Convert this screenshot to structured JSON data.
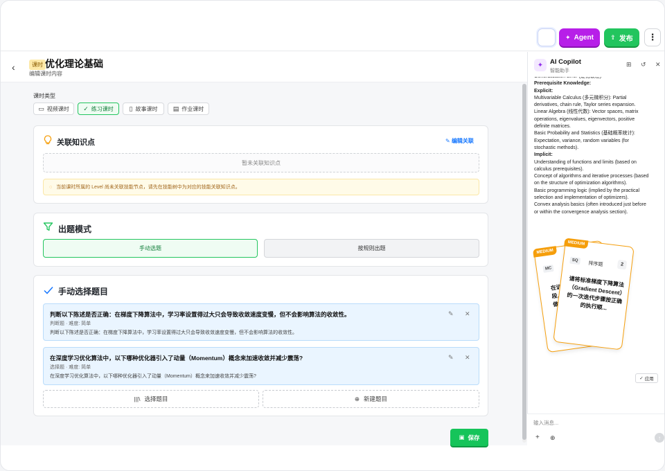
{
  "topbar": {
    "agent_label": "Agent",
    "publish_label": "发布",
    "more_icon": "more-vertical-icon"
  },
  "header": {
    "badge": "课时",
    "title": "优化理论基础",
    "subtitle": "编辑课时内容"
  },
  "lesson_type": {
    "label": "课时类型",
    "options": [
      {
        "label": "视频课时",
        "icon": "video-icon",
        "active": false
      },
      {
        "label": "练习课时",
        "icon": "check-icon",
        "active": true
      },
      {
        "label": "故事课时",
        "icon": "book-icon",
        "active": false
      },
      {
        "label": "作业课时",
        "icon": "clipboard-icon",
        "active": false
      }
    ]
  },
  "knowledge": {
    "title": "关联知识点",
    "edit_label": "编辑关联",
    "empty_text": "暂未关联知识点",
    "warning": "当前课时所属的 Level 尚未关联技能节点，请先在技能树中为对应的技能关联知识点。"
  },
  "mode": {
    "title": "出题模式",
    "manual_label": "手动选题",
    "rule_label": "按规则出题"
  },
  "manual": {
    "title": "手动选择题目",
    "questions": [
      {
        "title": "判断以下陈述是否正确：在梯度下降算法中，学习率设置得过大只会导致收敛速度变慢，但不会影响算法的收敛性。",
        "meta": "判断题 · 难度: 简单",
        "body": "判断以下陈述是否正确：在梯度下降算法中，学习率设置得过大只会导致收敛速度变慢，但不会影响算法的收敛性。"
      },
      {
        "title": "在深度学习优化算法中，以下哪种优化器引入了动量（Momentum）概念来加速收敛并减少震荡?",
        "meta": "选择题 · 难度: 简单",
        "body": "在深度学习优化算法中，以下哪种优化器引入了动量（Momentum）概念来加速收敛并减少震荡?"
      }
    ],
    "select_label": "选择题目",
    "create_label": "新建题目"
  },
  "save_label": "保存",
  "copilot": {
    "title": "AI Copilot",
    "subtitle": "智能助手",
    "text_lines": [
      {
        "t": "Generalization Error (泛化误差)",
        "b": false
      },
      {
        "t": "Prerequisite Knowledge:",
        "b": true
      },
      {
        "t": "Explicit:",
        "b": true
      },
      {
        "t": "Multivariable Calculus (多元微积分): Partial",
        "b": false
      },
      {
        "t": "derivatives, chain rule, Taylor series expansion.",
        "b": false
      },
      {
        "t": "Linear Algebra (线性代数): Vector spaces, matrix",
        "b": false
      },
      {
        "t": "operations, eigenvalues, eigenvectors, positive",
        "b": false
      },
      {
        "t": "definite matrices.",
        "b": false
      },
      {
        "t": "Basic Probability and Statistics (基础概率统计):",
        "b": false
      },
      {
        "t": "Expectation, variance, random variables (for",
        "b": false
      },
      {
        "t": "stochastic methods).",
        "b": false
      },
      {
        "t": "Implicit:",
        "b": true
      },
      {
        "t": "Understanding of functions and limits (based on",
        "b": false
      },
      {
        "t": "calculus prerequisites).",
        "b": false
      },
      {
        "t": "Concept of algorithms and iterative processes (based",
        "b": false
      },
      {
        "t": "on the structure of optimization algorithms).",
        "b": false
      },
      {
        "t": "Basic programming logic (implied by the practical",
        "b": false
      },
      {
        "t": "selection and implementation of optimizers).",
        "b": false
      },
      {
        "t": "Convex analysis basics (often introduced just before",
        "b": false
      },
      {
        "t": "or within the convergence analysis section).",
        "b": false
      }
    ],
    "cards": {
      "back": {
        "level": "MEDIUM",
        "tag": "MC",
        "text": "在训练\n段,\n做"
      },
      "front": {
        "level": "MEDIUM",
        "tag": "SQ",
        "tag_label": "排序题",
        "number": "2",
        "text": "请将标准梯度下降算法（Gradient Descent）的一次迭代步骤按正确的执行顺..."
      }
    },
    "apply_label": "应用",
    "input_placeholder": "输入消息..."
  }
}
